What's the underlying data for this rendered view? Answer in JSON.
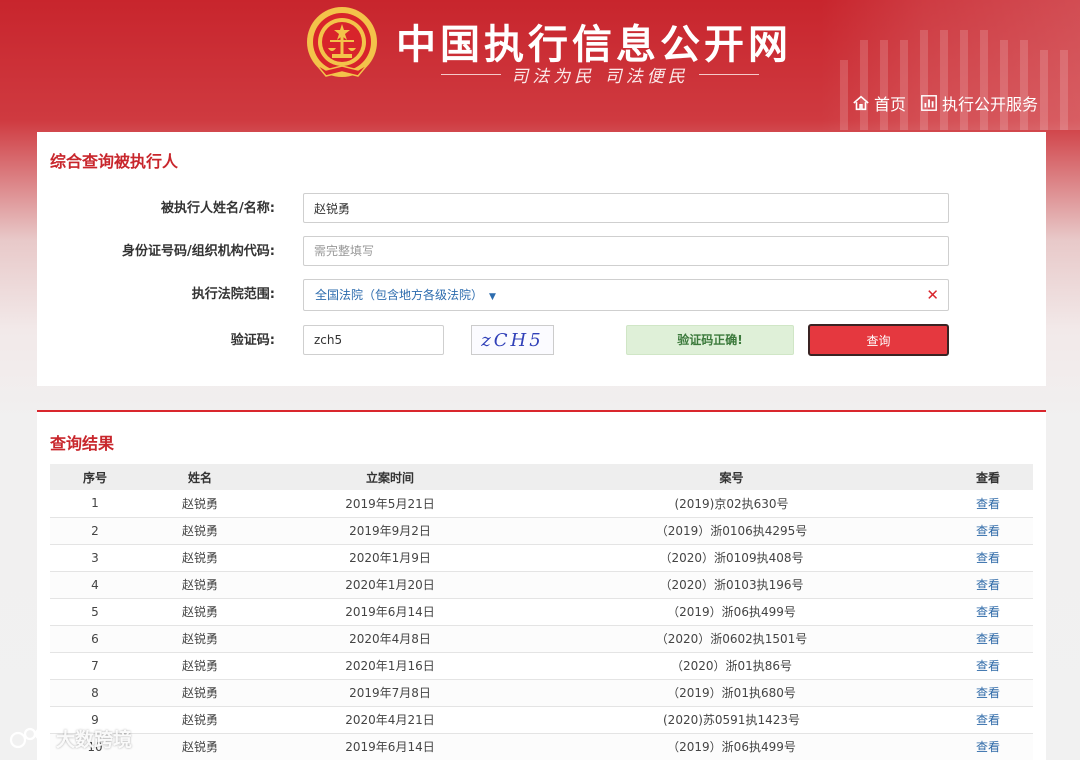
{
  "header": {
    "site_title": "中国执行信息公开网",
    "slogan": "司法为民 司法便民",
    "nav": [
      {
        "label": "首页",
        "icon": "home-icon"
      },
      {
        "label": "执行公开服务",
        "icon": "bar-chart-icon"
      }
    ]
  },
  "search": {
    "title": "综合查询被执行人",
    "name_label": "被执行人姓名/名称:",
    "name_value": "赵锐勇",
    "id_label": "身份证号码/组织机构代码:",
    "id_placeholder": "需完整填写",
    "court_label": "执行法院范围:",
    "court_value": "全国法院（包含地方各级法院）",
    "captcha_label": "验证码:",
    "captcha_value": "zch5",
    "captcha_image_text": "zCH5",
    "captcha_status": "验证码正确!",
    "query_button": "查询"
  },
  "results": {
    "title": "查询结果",
    "columns": [
      "序号",
      "姓名",
      "立案时间",
      "案号",
      "查看"
    ],
    "rows": [
      {
        "no": "1",
        "name": "赵锐勇",
        "date": "2019年5月21日",
        "case": "(2019)京02执630号",
        "view": "查看"
      },
      {
        "no": "2",
        "name": "赵锐勇",
        "date": "2019年9月2日",
        "case": "（2019）浙0106执4295号",
        "view": "查看"
      },
      {
        "no": "3",
        "name": "赵锐勇",
        "date": "2020年1月9日",
        "case": "（2020）浙0109执408号",
        "view": "查看"
      },
      {
        "no": "4",
        "name": "赵锐勇",
        "date": "2020年1月20日",
        "case": "（2020）浙0103执196号",
        "view": "查看"
      },
      {
        "no": "5",
        "name": "赵锐勇",
        "date": "2019年6月14日",
        "case": "（2019）浙06执499号",
        "view": "查看"
      },
      {
        "no": "6",
        "name": "赵锐勇",
        "date": "2020年4月8日",
        "case": "（2020）浙0602执1501号",
        "view": "查看"
      },
      {
        "no": "7",
        "name": "赵锐勇",
        "date": "2020年1月16日",
        "case": "（2020）浙01执86号",
        "view": "查看"
      },
      {
        "no": "8",
        "name": "赵锐勇",
        "date": "2019年7月8日",
        "case": "（2019）浙01执680号",
        "view": "查看"
      },
      {
        "no": "9",
        "name": "赵锐勇",
        "date": "2020年4月21日",
        "case": "(2020)苏0591执1423号",
        "view": "查看"
      },
      {
        "no": "10",
        "name": "赵锐勇",
        "date": "2019年6月14日",
        "case": "（2019）浙06执499号",
        "view": "查看"
      }
    ]
  },
  "watermark": {
    "text": "大数跨境"
  },
  "colors": {
    "brand_red": "#c8252d",
    "link_blue": "#2f6aa8",
    "success_green": "#dff0d8",
    "button_red": "#e5383f"
  }
}
